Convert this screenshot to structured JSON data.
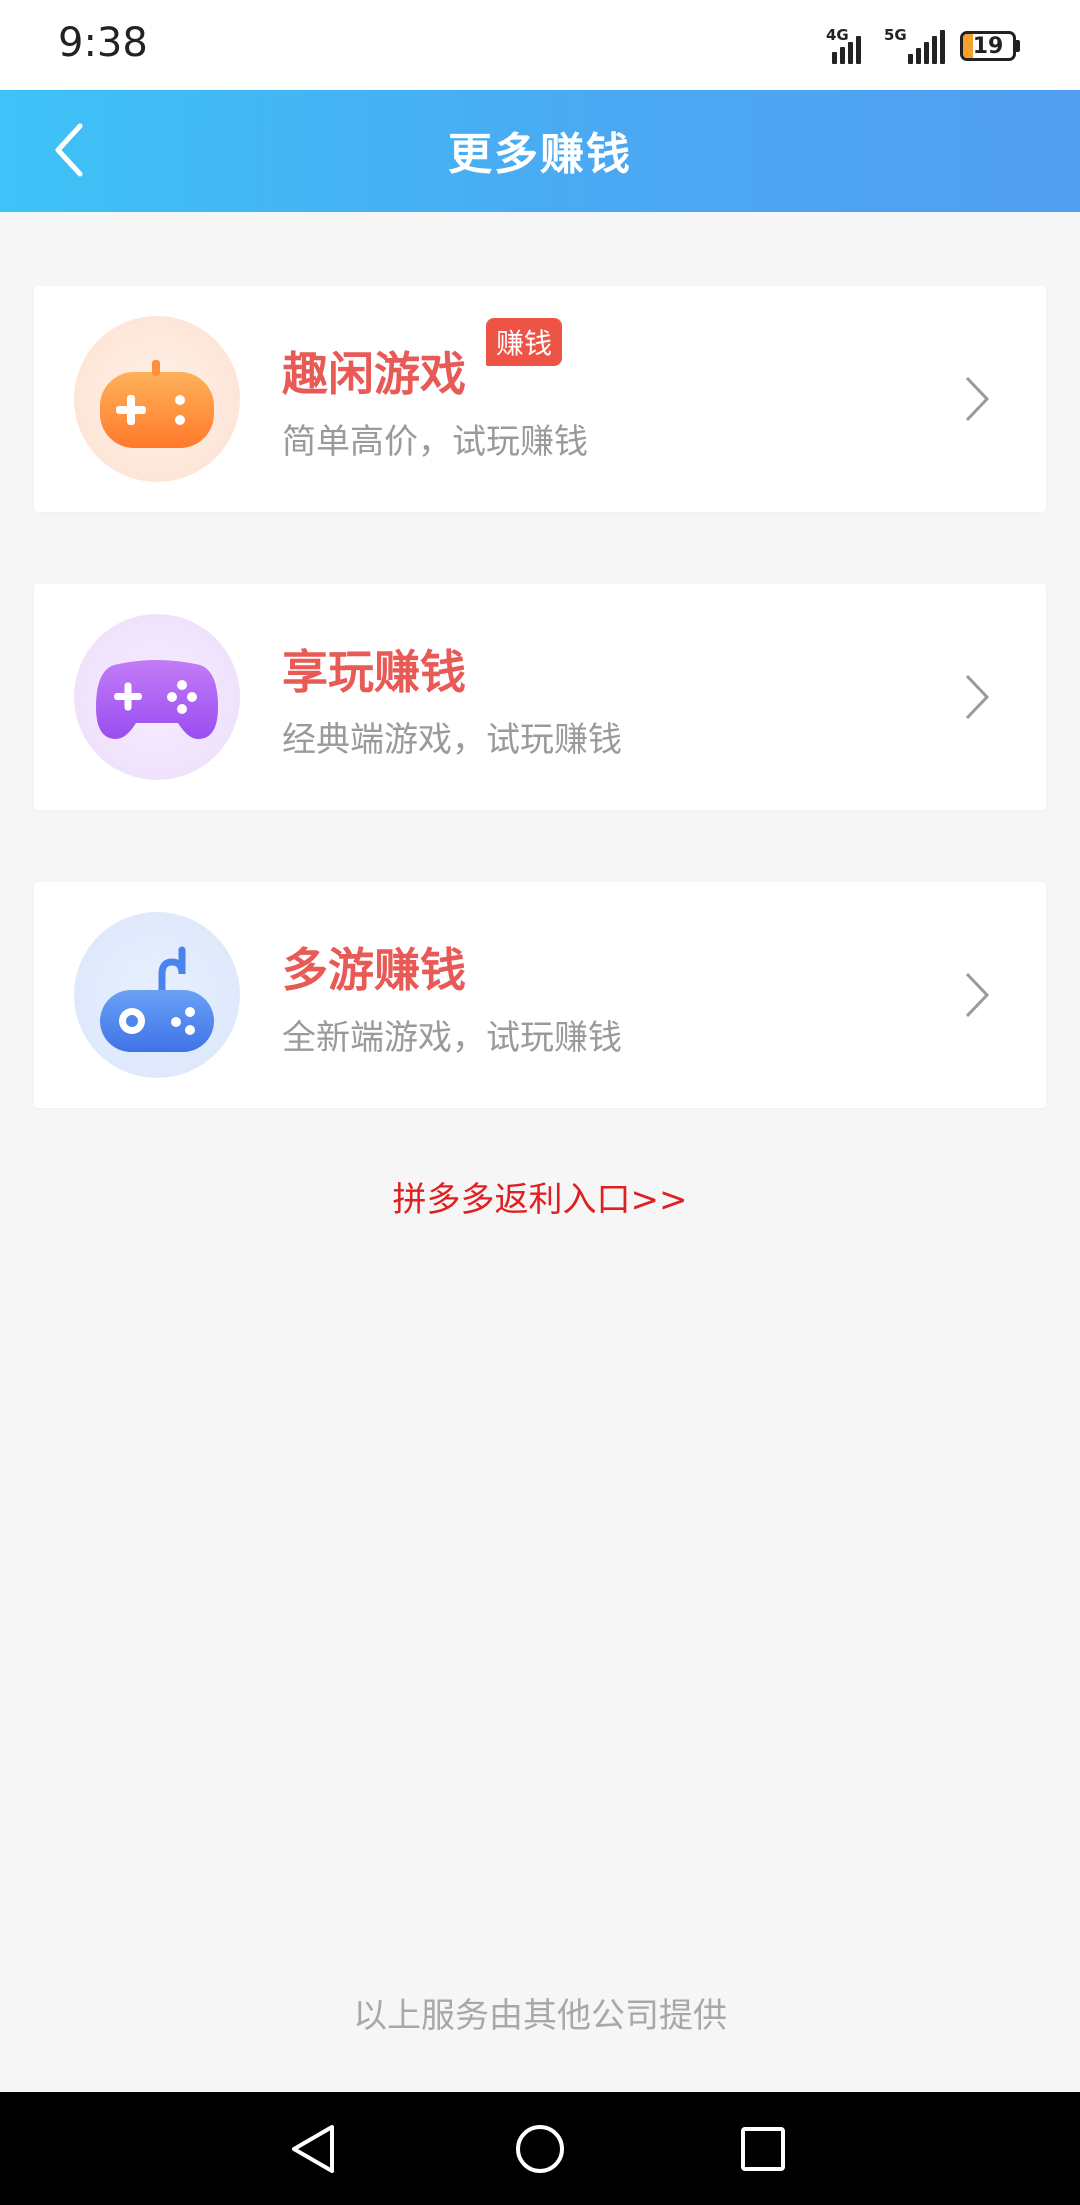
{
  "status_bar": {
    "time": "9:38",
    "network_1": "4G",
    "network_2": "5G",
    "battery": "19",
    "battery_level": 0.19,
    "battery_color": "#f7a12c"
  },
  "header": {
    "title": "更多赚钱",
    "back_icon": "chevron-left-icon",
    "gradient": [
      "#3ec2f7",
      "#529ef0"
    ]
  },
  "cards": [
    {
      "title": "趣闲游戏",
      "subtitle": "简单高价，试玩赚钱",
      "badge": "赚钱",
      "icon": "orange-gamepad-icon",
      "accent": "#ff8a3d"
    },
    {
      "title": "享玩赚钱",
      "subtitle": "经典端游戏，试玩赚钱",
      "icon": "purple-gamepad-icon",
      "accent": "#a75bf0"
    },
    {
      "title": "多游赚钱",
      "subtitle": "全新端游戏，试玩赚钱",
      "icon": "blue-joystick-icon",
      "accent": "#4f86ee"
    }
  ],
  "links": {
    "pdd": "拼多多返利入口>>"
  },
  "footer": {
    "note": "以上服务由其他公司提供"
  },
  "colors": {
    "title_red": "#e85a56",
    "link_red": "#e02020",
    "badge_red": "#ee5446"
  }
}
